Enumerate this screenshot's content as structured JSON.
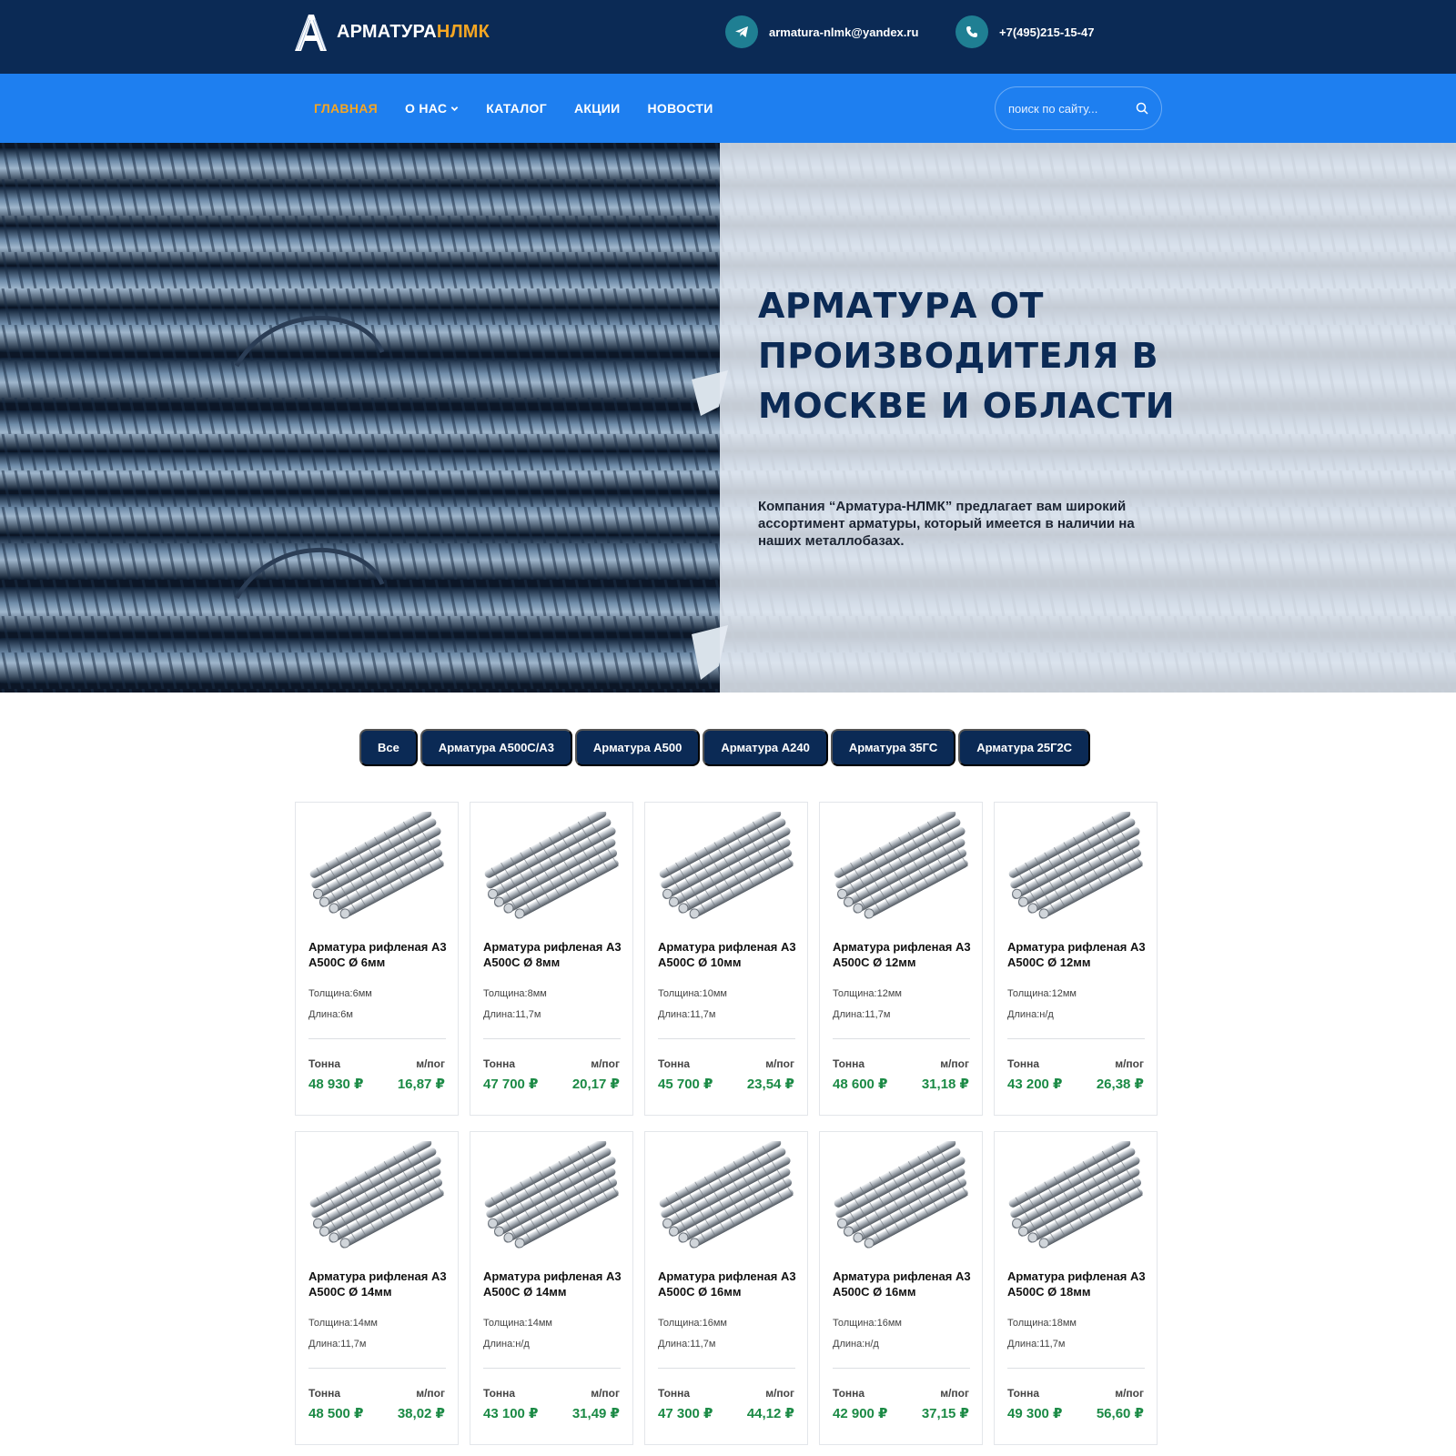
{
  "header": {
    "logo_white": "АРМАТУРА",
    "logo_orange": "НЛМК",
    "email": "armatura-nlmk@yandex.ru",
    "phone": "+7(495)215-15-47"
  },
  "nav": {
    "items": [
      {
        "label": "ГЛАВНАЯ"
      },
      {
        "label": "О НАС"
      },
      {
        "label": "КАТАЛОГ"
      },
      {
        "label": "АКЦИИ"
      },
      {
        "label": "НОВОСТИ"
      }
    ],
    "search_placeholder": "поиск по сайту..."
  },
  "hero": {
    "title": "АРМАТУРА ОТ ПРОИЗВОДИТЕЛЯ В МОСКВЕ И ОБЛАСТИ",
    "text": "Компания “Арматура-НЛМК” предлагает вам широкий ассортимент арматуры, который имеется в наличии на наших металлобазах."
  },
  "filters": [
    "Все",
    "Арматура А500С/А3",
    "Арматура А500",
    "Арматура А240",
    "Арматура 35ГС",
    "Арматура 25Г2С"
  ],
  "product_labels": {
    "price_left": "Тонна",
    "price_right": "м/пог"
  },
  "products": [
    {
      "title": "Арматура рифленая А3 А500С Ø 6мм",
      "thickness": "Толщина:6мм",
      "length": "Длина:6м",
      "price_ton": "48 930 ₽",
      "price_m": "16,87 ₽"
    },
    {
      "title": "Арматура рифленая А3 А500С Ø 8мм",
      "thickness": "Толщина:8мм",
      "length": "Длина:11,7м",
      "price_ton": "47 700 ₽",
      "price_m": "20,17 ₽"
    },
    {
      "title": "Арматура рифленая А3 А500С Ø 10мм",
      "thickness": "Толщина:10мм",
      "length": "Длина:11,7м",
      "price_ton": "45 700 ₽",
      "price_m": "23,54 ₽"
    },
    {
      "title": "Арматура рифленая А3 А500С Ø 12мм",
      "thickness": "Толщина:12мм",
      "length": "Длина:11,7м",
      "price_ton": "48 600 ₽",
      "price_m": "31,18 ₽"
    },
    {
      "title": "Арматура рифленая А3 А500С Ø 12мм",
      "thickness": "Толщина:12мм",
      "length": "Длина:н/д",
      "price_ton": "43 200 ₽",
      "price_m": "26,38 ₽"
    },
    {
      "title": "Арматура рифленая А3 А500С Ø 14мм",
      "thickness": "Толщина:14мм",
      "length": "Длина:11,7м",
      "price_ton": "48 500 ₽",
      "price_m": "38,02 ₽"
    },
    {
      "title": "Арматура рифленая А3 А500С Ø 14мм",
      "thickness": "Толщина:14мм",
      "length": "Длина:н/д",
      "price_ton": "43 100 ₽",
      "price_m": "31,49 ₽"
    },
    {
      "title": "Арматура рифленая А3 А500С Ø 16мм",
      "thickness": "Толщина:16мм",
      "length": "Длина:11,7м",
      "price_ton": "47 300 ₽",
      "price_m": "44,12 ₽"
    },
    {
      "title": "Арматура рифленая А3 А500С Ø 16мм",
      "thickness": "Толщина:16мм",
      "length": "Длина:н/д",
      "price_ton": "42 900 ₽",
      "price_m": "37,15 ₽"
    },
    {
      "title": "Арматура рифленая А3 А500С Ø 18мм",
      "thickness": "Толщина:18мм",
      "length": "Длина:11,7м",
      "price_ton": "49 300 ₽",
      "price_m": "56,60 ₽"
    }
  ],
  "colors": {
    "topbar": "#0b2a55",
    "navbar": "#1e7ff0",
    "accent_orange": "#f5a623",
    "price_green": "#1b8a45"
  },
  "icons": [
    "logo-a-icon",
    "telegram-icon",
    "phone-icon",
    "search-icon",
    "chevron-down-icon",
    "rebar-bundle-image"
  ]
}
